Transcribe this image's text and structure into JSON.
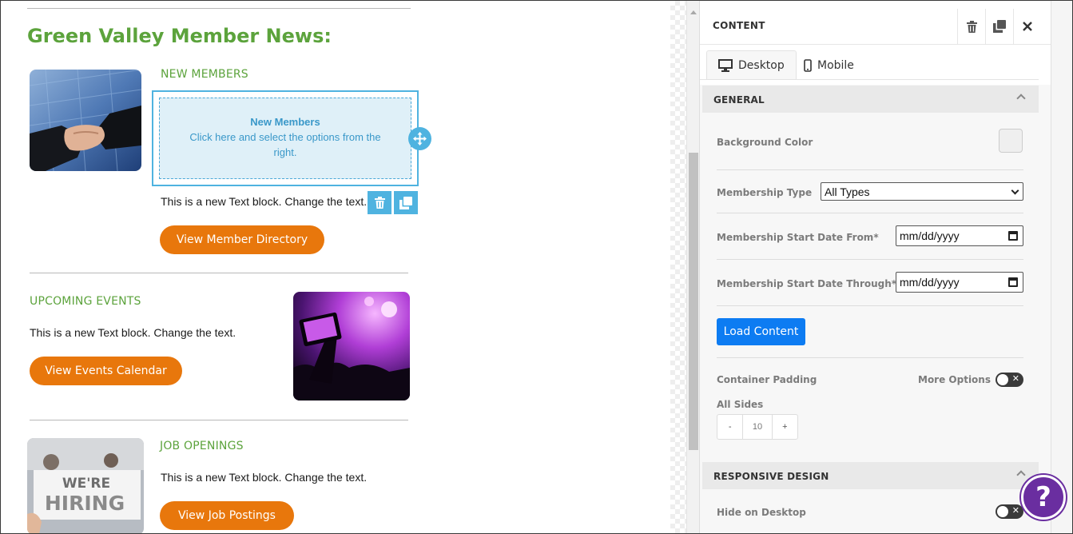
{
  "newsletter": {
    "title": "Green Valley Member News:",
    "sections": [
      {
        "heading": "NEW MEMBERS",
        "text": "This is a new Text block. Change the text.",
        "button": "View Member Directory",
        "image": "handshake-photo"
      },
      {
        "heading": "UPCOMING EVENTS",
        "text": "This is a new Text block. Change the text.",
        "button": "View Events Calendar",
        "image": "concert-photo"
      },
      {
        "heading": "JOB OPENINGS",
        "text": "This is a new Text block. Change the text.",
        "button": "View Job Postings",
        "image": "we-are-hiring-photo",
        "image_text_line1": "WE'RE",
        "image_text_line2": "HIRING"
      }
    ],
    "selected_block": {
      "title": "New Members",
      "subtitle": "Click here and select the options from the right."
    }
  },
  "panel": {
    "title": "CONTENT",
    "tabs": [
      {
        "label": "Desktop",
        "icon": "monitor-icon",
        "active": true
      },
      {
        "label": "Mobile",
        "icon": "phone-icon",
        "active": false
      }
    ],
    "general": {
      "header": "GENERAL",
      "background_color_label": "Background Color",
      "background_color": "#efefef",
      "membership_type_label": "Membership Type",
      "membership_type_value": "All Types",
      "start_from_label": "Membership Start Date From*",
      "start_from_placeholder": "mm/dd/yyyy",
      "start_through_label": "Membership Start Date Through*",
      "start_through_placeholder": "mm/dd/yyyy",
      "load_button": "Load Content",
      "container_padding_label": "Container Padding",
      "more_options_label": "More Options",
      "all_sides_label": "All Sides",
      "padding_minus": "-",
      "padding_value": "10",
      "padding_plus": "+"
    },
    "responsive": {
      "header": "RESPONSIVE DESIGN",
      "hide_desktop_label": "Hide on Desktop"
    }
  },
  "help_button": "?",
  "colors": {
    "green": "#5ca33c",
    "orange": "#e8770c",
    "blue": "#0d7cf2",
    "selection": "#4fb3e0",
    "help": "#6a2ea0"
  }
}
